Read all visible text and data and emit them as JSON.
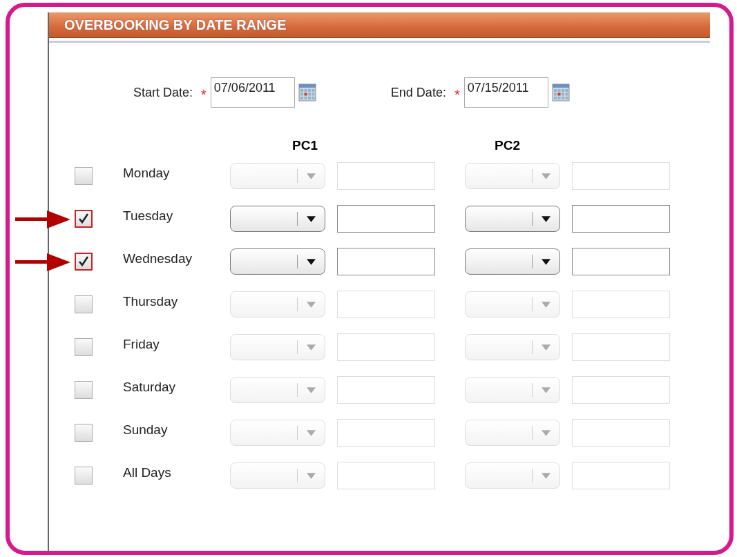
{
  "panel": {
    "title": "OVERBOOKING BY DATE RANGE"
  },
  "dates": [
    {
      "label": "Start Date:",
      "required_mark": "*",
      "value": "07/06/2011"
    },
    {
      "label": "End Date:",
      "required_mark": "*",
      "value": "07/15/2011"
    }
  ],
  "columns": [
    "PC1",
    "PC2"
  ],
  "rows": [
    {
      "day": "Monday",
      "checked": false,
      "annotated": false
    },
    {
      "day": "Tuesday",
      "checked": true,
      "annotated": true
    },
    {
      "day": "Wednesday",
      "checked": true,
      "annotated": true
    },
    {
      "day": "Thursday",
      "checked": false,
      "annotated": false
    },
    {
      "day": "Friday",
      "checked": false,
      "annotated": false
    },
    {
      "day": "Saturday",
      "checked": false,
      "annotated": false
    },
    {
      "day": "Sunday",
      "checked": false,
      "annotated": false
    },
    {
      "day": "All Days",
      "checked": false,
      "annotated": false
    }
  ]
}
